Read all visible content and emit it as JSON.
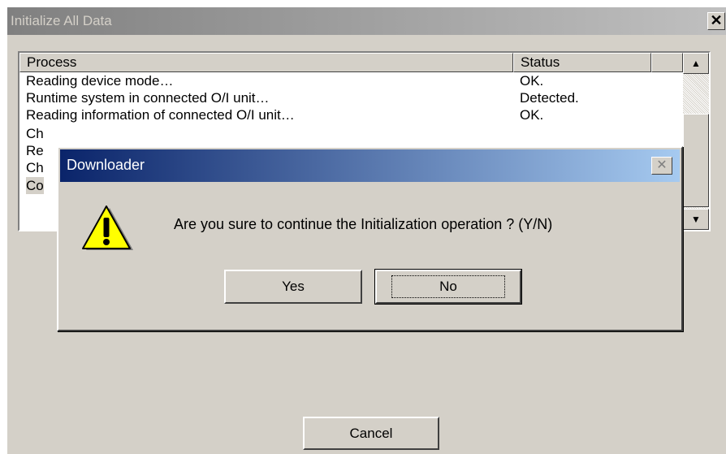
{
  "window": {
    "title": "Initialize All Data",
    "close_glyph": "✕"
  },
  "listview": {
    "headers": {
      "process": "Process",
      "status": "Status"
    },
    "rows": [
      {
        "process": "Reading device mode…",
        "status": "OK."
      },
      {
        "process": "Runtime system in connected O/I unit…",
        "status": "Detected."
      },
      {
        "process": "Reading information of connected O/I unit…",
        "status": "OK."
      },
      {
        "process": "Ch",
        "status": ""
      },
      {
        "process": "Re",
        "status": ""
      },
      {
        "process": "Ch",
        "status": ""
      },
      {
        "process": "Co",
        "status": ""
      }
    ],
    "scroll_up_glyph": "▲",
    "scroll_down_glyph": "▼"
  },
  "buttons": {
    "cancel": "Cancel"
  },
  "dialog": {
    "title": "Downloader",
    "close_glyph": "✕",
    "message": "Are you sure to continue the Initialization operation ? (Y/N)",
    "yes": "Yes",
    "no": "No",
    "icon": "warning-icon"
  },
  "colors": {
    "face": "#d4d0c8",
    "active_title_start": "#0a246a",
    "active_title_end": "#a6caf0",
    "warning_yellow": "#ffff00"
  }
}
